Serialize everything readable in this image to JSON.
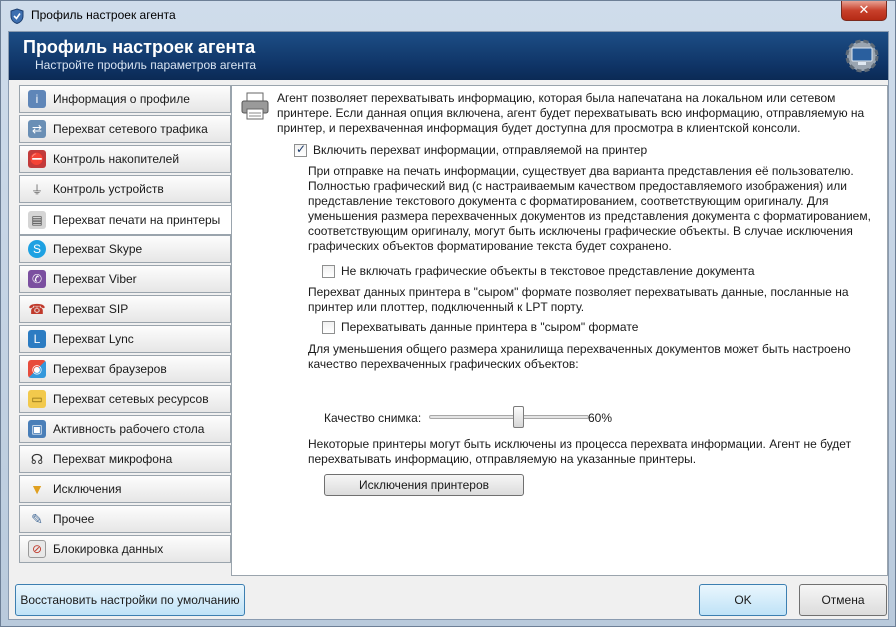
{
  "window": {
    "title": "Профиль настроек агента",
    "close_label": "✕"
  },
  "header": {
    "title": "Профиль настроек агента",
    "subtitle": "Настройте профиль параметров агента"
  },
  "sidebar": {
    "items": [
      {
        "label": "Информация о профиле",
        "icon": "profile-info-icon"
      },
      {
        "label": "Перехват сетевого трафика",
        "icon": "network-traffic-icon"
      },
      {
        "label": "Контроль накопителей",
        "icon": "storage-control-icon"
      },
      {
        "label": "Контроль устройств",
        "icon": "usb-device-icon"
      },
      {
        "label": "Перехват печати на принтеры",
        "icon": "printer-icon",
        "active": true
      },
      {
        "label": "Перехват Skype",
        "icon": "skype-icon"
      },
      {
        "label": "Перехват Viber",
        "icon": "viber-icon"
      },
      {
        "label": "Перехват SIP",
        "icon": "phone-icon"
      },
      {
        "label": "Перехват Lync",
        "icon": "lync-icon"
      },
      {
        "label": "Перехват браузеров",
        "icon": "browser-icon"
      },
      {
        "label": "Перехват сетевых ресурсов",
        "icon": "folder-icon"
      },
      {
        "label": "Активность рабочего стола",
        "icon": "desktop-icon"
      },
      {
        "label": "Перехват микрофона",
        "icon": "headset-icon"
      },
      {
        "label": "Исключения",
        "icon": "filter-icon"
      },
      {
        "label": "Прочее",
        "icon": "tools-icon"
      },
      {
        "label": "Блокировка данных",
        "icon": "block-data-icon"
      }
    ]
  },
  "content": {
    "intro": "Агент позволяет перехватывать информацию, которая была напечатана на локальном или сетевом принтере. Если данная опция включена, агент будет перехватывать всю информацию, отправляемую на принтер, и перехваченная информация будет доступна для просмотра в клиентской консоли.",
    "enable_label": "Включить перехват информации, отправляемой на принтер",
    "enable_checked": true,
    "para1": "При отправке на печать информации, существует два варианта представления её пользователю. Полностью графический вид (с настраиваемым качеством предоставляемого изображения) или представление текстового документа с форматированием, соответствующим оригиналу. Для уменьшения размера перехваченных документов из представления документа с форматированием, соответствующим оригиналу, могут быть исключены графические объекты. В случае исключения графических объектов форматирование текста будет сохранено.",
    "exclude_graphics_label": "Не включать графические объекты в текстовое представление документа",
    "para2": "Перехват данных принтера в \"сыром\" формате позволяет перехватывать данные, посланные на принтер или плоттер, подключенный к LPT порту.",
    "raw_label": "Перехватывать данные принтера в \"сыром\" формате",
    "para3": "Для уменьшения общего размера хранилища перехваченных документов может быть настроено качество перехваченных графических объектов:",
    "quality_label": "Качество снимка:",
    "quality_value": "60%",
    "quality_fraction": 0.6,
    "para4": "Некоторые принтеры могут быть исключены из процесса перехвата информации. Агент не будет перехватывать информацию, отправляемую на указанные принтеры.",
    "exclusions_button": "Исключения принтеров"
  },
  "footer": {
    "restore_button": "Восстановить настройки по умолчанию",
    "ok_button": "OK",
    "cancel_button": "Отмена"
  }
}
